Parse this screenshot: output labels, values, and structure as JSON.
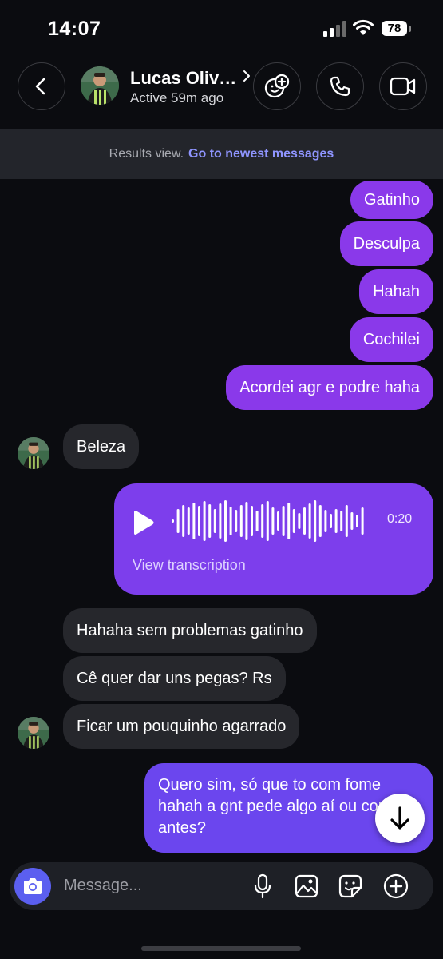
{
  "status_bar": {
    "time": "14:07",
    "battery": "78"
  },
  "header": {
    "contact_name": "Lucas Oliv…",
    "status": "Active 59m ago"
  },
  "results_banner": {
    "label": "Results view.",
    "link": "Go to newest messages"
  },
  "messages": [
    {
      "side": "out",
      "text": "Gatinho"
    },
    {
      "side": "out",
      "text": "Desculpa"
    },
    {
      "side": "out",
      "text": "Hahah"
    },
    {
      "side": "out",
      "text": "Cochilei"
    },
    {
      "side": "out",
      "text": "Acordei agr e podre haha"
    },
    {
      "side": "in",
      "text": "Beleza"
    },
    {
      "side": "out",
      "type": "voice",
      "duration": "0:20",
      "link": "View transcription"
    },
    {
      "side": "in",
      "text": "Hahaha sem problemas gatinho"
    },
    {
      "side": "in",
      "text": "Cê quer dar uns pegas? Rs"
    },
    {
      "side": "in",
      "text": "Ficar um pouquinho agarrado"
    },
    {
      "side": "out",
      "text": "Quero sim, só que to com fome hahah a gnt pede algo aí ou como antes?"
    }
  ],
  "composer": {
    "placeholder": "Message..."
  },
  "colors": {
    "outgoing": "#8a39ea",
    "outgoing_last": "#6b46ee",
    "incoming": "#26272c",
    "link": "#8f95ff",
    "background": "#0b0c10"
  },
  "icons": [
    "back-arrow-icon",
    "chevron-right-icon",
    "add-people-icon",
    "phone-icon",
    "video-camera-icon",
    "play-icon",
    "arrow-down-icon",
    "camera-icon",
    "microphone-icon",
    "image-icon",
    "sticker-icon",
    "plus-icon"
  ]
}
